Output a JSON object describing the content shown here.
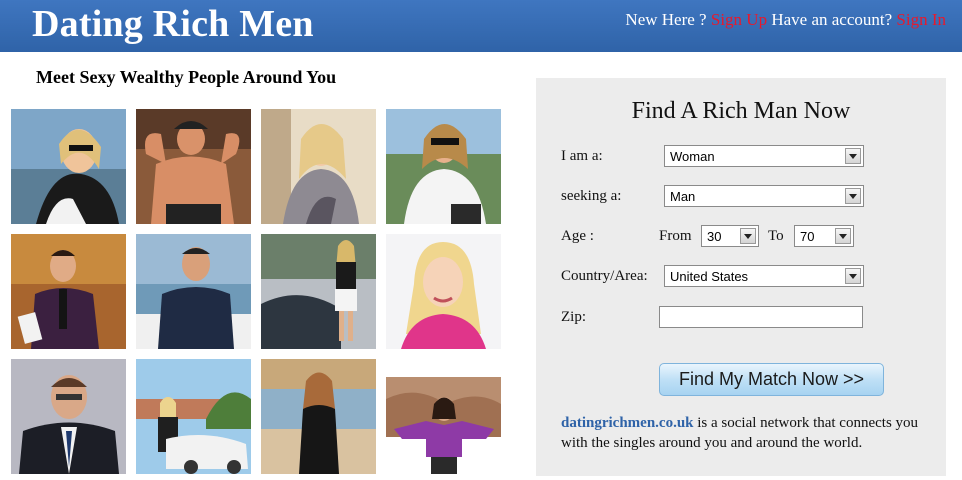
{
  "header": {
    "logo": "Dating Rich Men",
    "new_here": "New Here ?",
    "sign_up": "Sign Up",
    "have_account": "Have an account?",
    "sign_in": "Sign In"
  },
  "tagline": "Meet Sexy Wealthy People Around You",
  "photos": [
    {
      "name": "profile-photo-1"
    },
    {
      "name": "profile-photo-2"
    },
    {
      "name": "profile-photo-3"
    },
    {
      "name": "profile-photo-4"
    },
    {
      "name": "profile-photo-5"
    },
    {
      "name": "profile-photo-6"
    },
    {
      "name": "profile-photo-7"
    },
    {
      "name": "profile-photo-8"
    },
    {
      "name": "profile-photo-9"
    },
    {
      "name": "profile-photo-10"
    },
    {
      "name": "profile-photo-11"
    },
    {
      "name": "profile-photo-12"
    }
  ],
  "search": {
    "title": "Find A Rich Man Now",
    "i_am_label": "I am a:",
    "i_am_value": "Woman",
    "seeking_label": "seeking a:",
    "seeking_value": "Man",
    "age_label": "Age :",
    "from_label": "From",
    "age_from": "30",
    "to_label": "To",
    "age_to": "70",
    "country_label": "Country/Area:",
    "country_value": "United States",
    "zip_label": "Zip:",
    "zip_value": "",
    "submit_label": "Find My Match Now >>",
    "site_name": "datingrichmen.co.uk",
    "description": " is a social network that connects you with the singles around you and around the world."
  },
  "colors": {
    "header_bg": "#3a6fb8",
    "sign_link": "#e8192c",
    "panel_bg": "#ececec",
    "site_link": "#2f63a8"
  }
}
